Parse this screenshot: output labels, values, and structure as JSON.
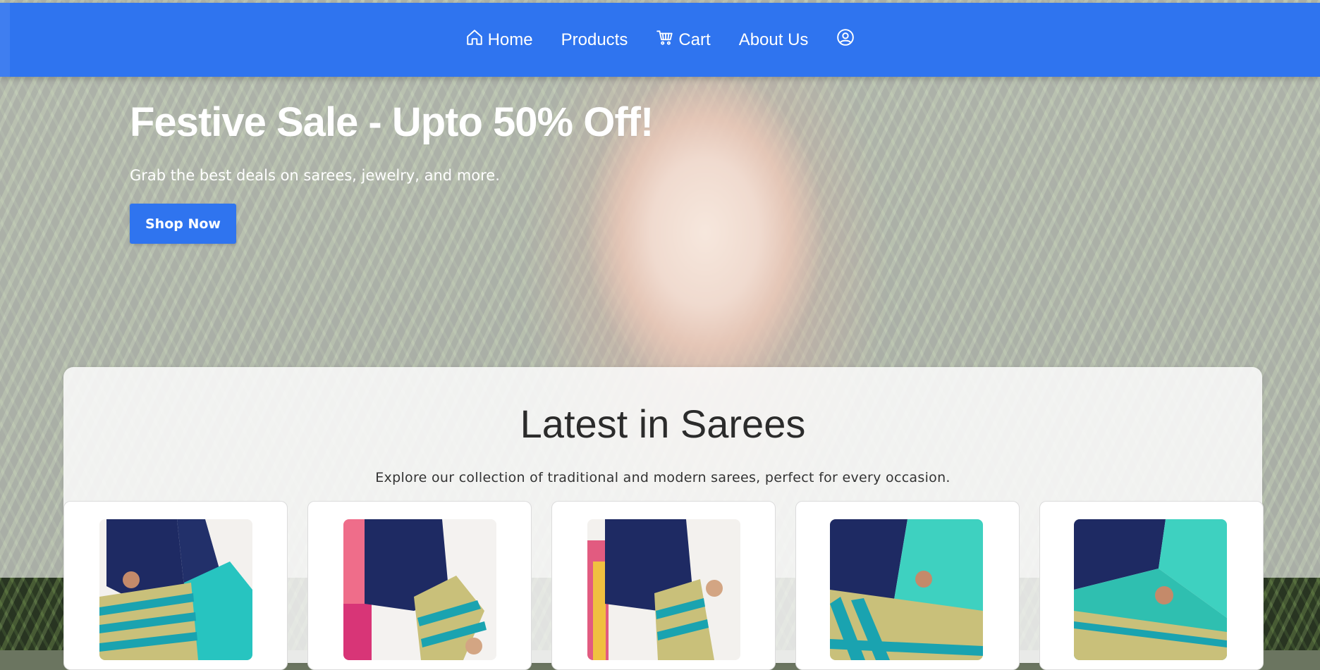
{
  "nav": {
    "items": [
      {
        "label": "Home",
        "icon": "home-icon"
      },
      {
        "label": "Products",
        "icon": ""
      },
      {
        "label": "Cart",
        "icon": "cart-icon"
      },
      {
        "label": "About Us",
        "icon": ""
      }
    ],
    "profile_icon": "user-circle-icon",
    "color": "#2f74ef"
  },
  "hero": {
    "title": "Festive Sale - Upto 50% Off!",
    "subtitle": "Grab the best deals on sarees, jewelry, and more.",
    "button_label": "Shop Now"
  },
  "section": {
    "title": "Latest in Sarees",
    "subtitle": "Explore our collection of traditional and modern sarees, perfect for every occasion.",
    "products": [
      {
        "image": "saree-navy-teal-gold"
      },
      {
        "image": "saree-navy-pink-teal"
      },
      {
        "image": "saree-navy-teal-gold-stack"
      },
      {
        "image": "saree-navy-turquoise-drape"
      },
      {
        "image": "saree-navy-turquoise-pallu"
      }
    ]
  }
}
